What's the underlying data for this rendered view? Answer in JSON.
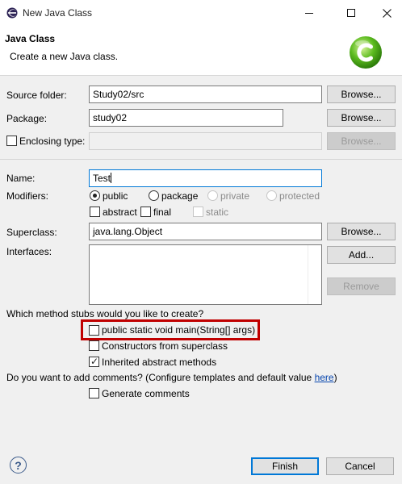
{
  "window": {
    "title": "New Java Class",
    "controls": {
      "minimize_icon": "minimize-icon",
      "maximize_icon": "maximize-icon",
      "close_icon": "close-icon"
    }
  },
  "header": {
    "title": "Java Class",
    "description": "Create a new Java class.",
    "logo_icon": "new-class-wizard-icon"
  },
  "form": {
    "source_folder": {
      "label": "Source folder:",
      "value": "Study02/src",
      "button": "Browse..."
    },
    "package": {
      "label": "Package:",
      "value": "study02",
      "button": "Browse..."
    },
    "enclosing_type": {
      "label": "Enclosing type:",
      "checked": false,
      "value": "",
      "button": "Browse..."
    },
    "name": {
      "label": "Name:",
      "value": "Test"
    },
    "modifiers": {
      "label": "Modifiers:",
      "radios": [
        {
          "label": "public",
          "selected": true,
          "enabled": true
        },
        {
          "label": "package",
          "selected": false,
          "enabled": true
        },
        {
          "label": "private",
          "selected": false,
          "enabled": false
        },
        {
          "label": "protected",
          "selected": false,
          "enabled": false
        }
      ],
      "checks": [
        {
          "label": "abstract",
          "checked": false,
          "enabled": true
        },
        {
          "label": "final",
          "checked": false,
          "enabled": true
        },
        {
          "label": "static",
          "checked": false,
          "enabled": false
        }
      ]
    },
    "superclass": {
      "label": "Superclass:",
      "value": "java.lang.Object",
      "button": "Browse..."
    },
    "interfaces": {
      "label": "Interfaces:",
      "add_button": "Add...",
      "remove_button": "Remove",
      "items": []
    },
    "stubs": {
      "question": "Which method stubs would you like to create?",
      "options": [
        {
          "label": "public static void main(String[] args)",
          "checked": false
        },
        {
          "label": "Constructors from superclass",
          "checked": false
        },
        {
          "label": "Inherited abstract methods",
          "checked": true
        }
      ]
    },
    "comments": {
      "question_prefix": "Do you want to add comments? (Configure templates and default value ",
      "link": "here",
      "question_suffix": ")",
      "option": {
        "label": "Generate comments",
        "checked": false
      }
    }
  },
  "footer": {
    "help_icon": "help-icon",
    "help_glyph": "?",
    "finish": "Finish",
    "cancel": "Cancel"
  },
  "colors": {
    "highlight_border": "#c00000",
    "accent": "#0078d7",
    "link": "#0645ad"
  }
}
